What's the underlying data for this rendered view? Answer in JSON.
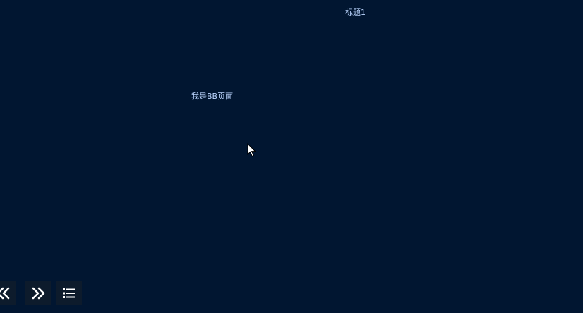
{
  "header": {
    "title": "标题1"
  },
  "main": {
    "content_text": "我是BB页面"
  },
  "nav": {
    "prev_icon": "double-chevron-left-icon",
    "next_icon": "double-chevron-right-icon",
    "menu_icon": "list-icon"
  },
  "colors": {
    "background": "#011631",
    "text": "#bcd6ff",
    "button_bg": "#0d1b2c",
    "icon": "#ffffff"
  }
}
